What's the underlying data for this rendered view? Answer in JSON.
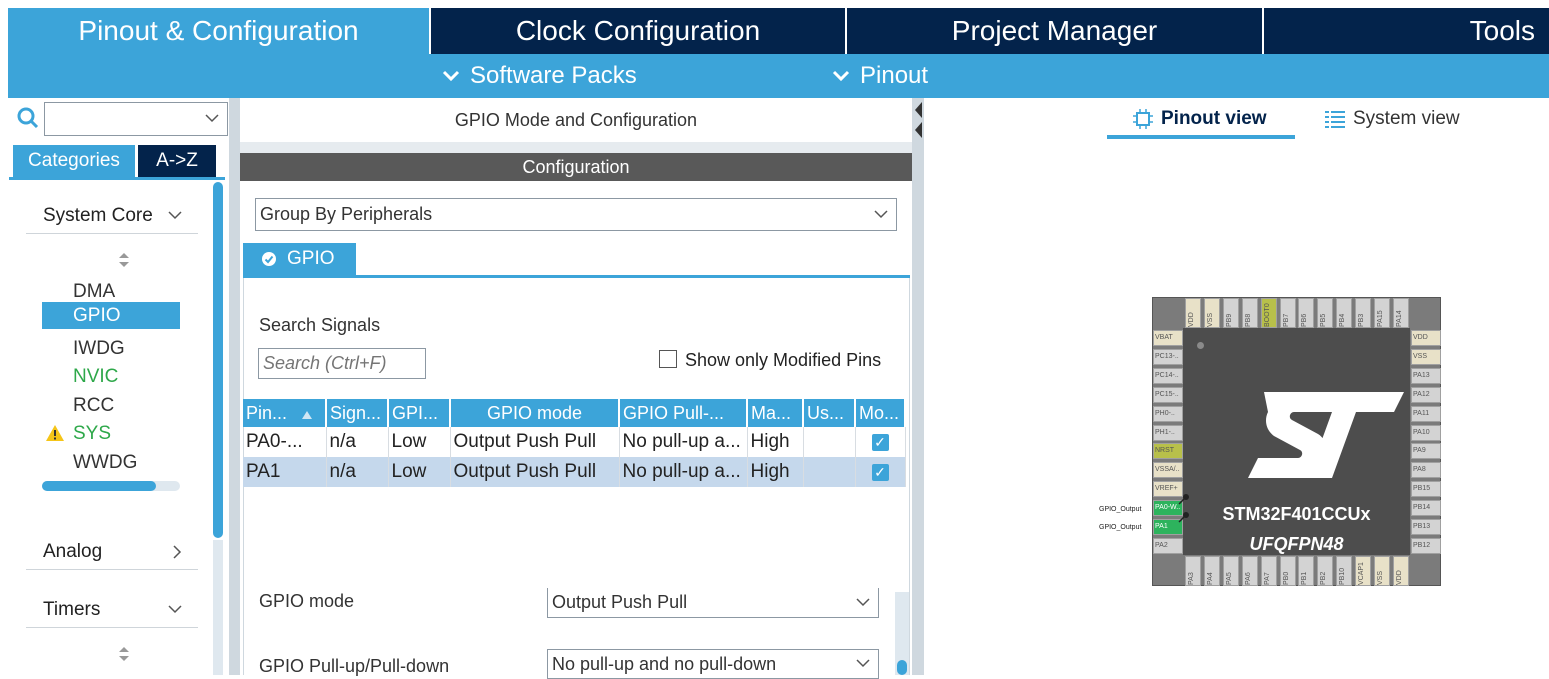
{
  "top_tabs": [
    {
      "label": "Pinout & Configuration",
      "active": true
    },
    {
      "label": "Clock Configuration",
      "active": false
    },
    {
      "label": "Project Manager",
      "active": false
    },
    {
      "label": "Tools",
      "active": false
    }
  ],
  "sub_menu": {
    "software_packs": "Software Packs",
    "pinout": "Pinout"
  },
  "sidebar": {
    "search_value": "",
    "tab_categories": "Categories",
    "tab_az": "A->Z",
    "system_core": "System Core",
    "items": [
      {
        "label": "DMA",
        "color": "#333333",
        "selected": false,
        "warning": false
      },
      {
        "label": "GPIO",
        "color": "#ffffff",
        "selected": true,
        "warning": false
      },
      {
        "label": "IWDG",
        "color": "#333333",
        "selected": false,
        "warning": false
      },
      {
        "label": "NVIC",
        "color": "#2ea84a",
        "selected": false,
        "warning": false
      },
      {
        "label": "RCC",
        "color": "#333333",
        "selected": false,
        "warning": false
      },
      {
        "label": "SYS",
        "color": "#2ea84a",
        "selected": false,
        "warning": true
      },
      {
        "label": "WWDG",
        "color": "#333333",
        "selected": false,
        "warning": false
      }
    ],
    "analog": "Analog",
    "timers": "Timers"
  },
  "center": {
    "title": "GPIO Mode and Configuration",
    "config_header": "Configuration",
    "group_by": "Group By Peripherals",
    "gpio_tab": "GPIO",
    "search_signals_label": "Search Signals",
    "search_placeholder": "Search (Ctrl+F)",
    "show_modified": "Show only Modified Pins",
    "columns": [
      "Pin...",
      "Sign...",
      "GPI...",
      "GPIO mode",
      "GPIO Pull-...",
      "Ma...",
      "Us...",
      "Mo..."
    ],
    "rows": [
      {
        "pin": "PA0-...",
        "signal": "n/a",
        "output": "Low",
        "mode": "Output Push Pull",
        "pull": "No pull-up a...",
        "speed": "High",
        "user": "",
        "modified": true
      },
      {
        "pin": "PA1",
        "signal": "n/a",
        "output": "Low",
        "mode": "Output Push Pull",
        "pull": "No pull-up a...",
        "speed": "High",
        "user": "",
        "modified": true
      }
    ],
    "gpio_mode_label": "GPIO mode",
    "gpio_mode_value": "Output Push Pull",
    "pull_label": "GPIO Pull-up/Pull-down",
    "pull_value": "No pull-up and no pull-down"
  },
  "right": {
    "pinout_view": "Pinout view",
    "system_view": "System view",
    "chip_name": "STM32F401CCUx",
    "package": "UFQFPN48",
    "top_pins": [
      "VDD",
      "VSS",
      "PB9",
      "PB8",
      "BOOT0",
      "PB7",
      "PB6",
      "PB5",
      "PB4",
      "PB3",
      "PA15",
      "PA14"
    ],
    "left_pins": [
      "VBAT",
      "PC13-..",
      "PC14-..",
      "PC15-..",
      "PH0-..",
      "PH1-..",
      "NRST",
      "VSSA/..",
      "VREF+",
      "PA0-W..",
      "PA1",
      "PA2"
    ],
    "right_pins": [
      "VDD",
      "VSS",
      "PA13",
      "PA12",
      "PA11",
      "PA10",
      "PA9",
      "PA8",
      "PB15",
      "PB14",
      "PB13",
      "PB12"
    ],
    "bottom_pins": [
      "PA3",
      "PA4",
      "PA5",
      "PA6",
      "PA7",
      "PB0",
      "PB1",
      "PB2",
      "PB10",
      "VCAP1",
      "VSS",
      "VDD"
    ],
    "signal_labels": [
      "GPIO_Output",
      "GPIO_Output"
    ]
  }
}
